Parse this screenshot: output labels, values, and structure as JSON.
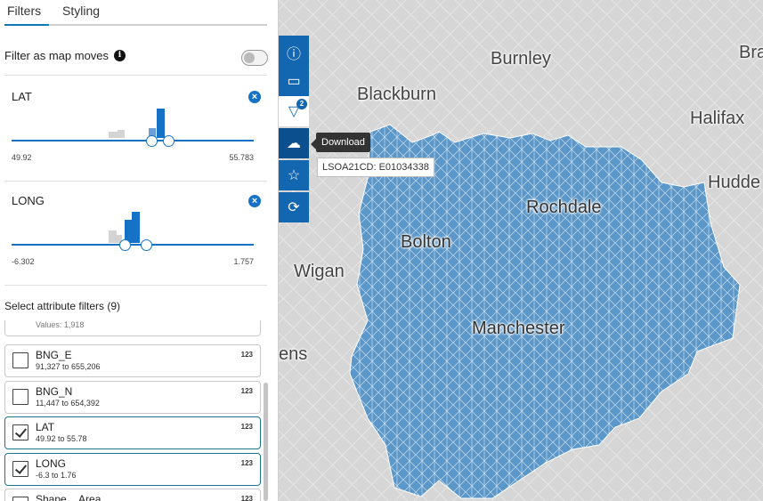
{
  "tabs": [
    {
      "label": "Filters",
      "active": true
    },
    {
      "label": "Styling",
      "active": false
    }
  ],
  "filter_as_map_moves": {
    "label": "Filter as map moves",
    "info_icon": "i",
    "enabled": false
  },
  "range_filters": [
    {
      "name": "LAT",
      "clear_icon": "×",
      "min": "49.92",
      "max": "55.783"
    },
    {
      "name": "LONG",
      "clear_icon": "×",
      "min": "-6.302",
      "max": "1.757"
    }
  ],
  "attribute_filters": {
    "title": "Select attribute filters (9)",
    "items": [
      {
        "name": "",
        "sub": "Values: 1,918",
        "type": "",
        "checked": false
      },
      {
        "name": "BNG_E",
        "sub": "91,327 to 655,206",
        "type": "123",
        "checked": false
      },
      {
        "name": "BNG_N",
        "sub": "11,447 to 654,392",
        "type": "123",
        "checked": false
      },
      {
        "name": "LAT",
        "sub": "49.92 to 55.78",
        "type": "123",
        "checked": true
      },
      {
        "name": "LONG",
        "sub": "-6.3 to 1.76",
        "type": "123",
        "checked": true
      },
      {
        "name": "Shape__Area",
        "sub": "",
        "type": "123",
        "checked": false
      }
    ]
  },
  "map": {
    "places": [
      "Burnley",
      "Blackburn",
      "Halifax",
      "Rochdale",
      "Bolton",
      "Wigan",
      "Manchester",
      "Hudde",
      "Bra",
      "ens"
    ],
    "tooltip": "Download",
    "feature_label": "LSOA21CD: E01034338",
    "region_color": "#5b97c9"
  },
  "toolbar": {
    "buttons": [
      {
        "icon": "info-icon",
        "glyph": "ⓘ"
      },
      {
        "icon": "comment-icon",
        "glyph": "▭"
      },
      {
        "icon": "filter-icon",
        "glyph": "▽",
        "badge": "2"
      },
      {
        "icon": "download-icon",
        "glyph": "☁"
      },
      {
        "icon": "star-icon",
        "glyph": "☆"
      },
      {
        "icon": "refresh-icon",
        "glyph": "⟳"
      }
    ]
  }
}
